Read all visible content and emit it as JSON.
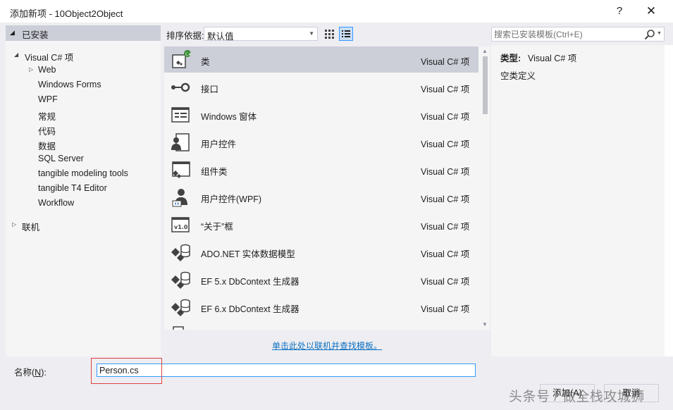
{
  "window": {
    "title": "添加新项 - 10Object2Object",
    "help_label": "?",
    "close_label": "✕"
  },
  "left_panel": {
    "installed_label": "已安装",
    "tree": [
      {
        "label": "Visual C# 项",
        "level": 0,
        "expanded": true
      },
      {
        "label": "Web",
        "level": 1,
        "expandable": true
      },
      {
        "label": "Windows Forms",
        "level": 1
      },
      {
        "label": "WPF",
        "level": 1
      },
      {
        "label": "常规",
        "level": 1
      },
      {
        "label": "代码",
        "level": 1
      },
      {
        "label": "数据",
        "level": 1
      },
      {
        "label": "SQL Server",
        "level": 1
      },
      {
        "label": "tangible modeling tools",
        "level": 1
      },
      {
        "label": "tangible T4 Editor",
        "level": 1
      },
      {
        "label": "Workflow",
        "level": 1
      }
    ],
    "online_label": "联机"
  },
  "toolbar": {
    "sort_label": "排序依据:",
    "sort_value": "默认值",
    "view_grid_icon": "grid-view-icon",
    "view_list_icon": "list-view-icon"
  },
  "templates": {
    "selected_index": 0,
    "items": [
      {
        "name": "类",
        "type": "Visual C# 项",
        "icon": "class-icon"
      },
      {
        "name": "接口",
        "type": "Visual C# 项",
        "icon": "interface-icon"
      },
      {
        "name": "Windows 窗体",
        "type": "Visual C# 项",
        "icon": "windows-form-icon"
      },
      {
        "name": "用户控件",
        "type": "Visual C# 项",
        "icon": "user-control-icon"
      },
      {
        "name": "组件类",
        "type": "Visual C# 项",
        "icon": "component-class-icon"
      },
      {
        "name": "用户控件(WPF)",
        "type": "Visual C# 项",
        "icon": "wpf-user-control-icon"
      },
      {
        "name": "“关于”框",
        "type": "Visual C# 项",
        "icon": "about-box-icon"
      },
      {
        "name": "ADO.NET 实体数据模型",
        "type": "Visual C# 项",
        "icon": "entity-model-icon"
      },
      {
        "name": "EF 5.x DbContext 生成器",
        "type": "Visual C# 项",
        "icon": "dbcontext-generator-icon"
      },
      {
        "name": "EF 6.x DbContext 生成器",
        "type": "Visual C# 项",
        "icon": "dbcontext-generator-icon"
      }
    ],
    "online_link": "单击此处以联机并查找模板。"
  },
  "search": {
    "placeholder": "搜索已安装模板(Ctrl+E)"
  },
  "details": {
    "type_label": "类型:",
    "type_value": "Visual C# 项",
    "description": "空类定义"
  },
  "bottom": {
    "name_label_prefix": "名称(",
    "name_label_key": "N",
    "name_label_suffix": "):",
    "name_value": "Person.cs",
    "add_button": "添加(A)",
    "cancel_button": "取消"
  },
  "watermark": "头条号 / 做全栈攻城狮",
  "colors": {
    "accent": "#3399ff",
    "selection": "#ccced8",
    "link": "#0e70c0",
    "highlight_box": "#e04040"
  }
}
